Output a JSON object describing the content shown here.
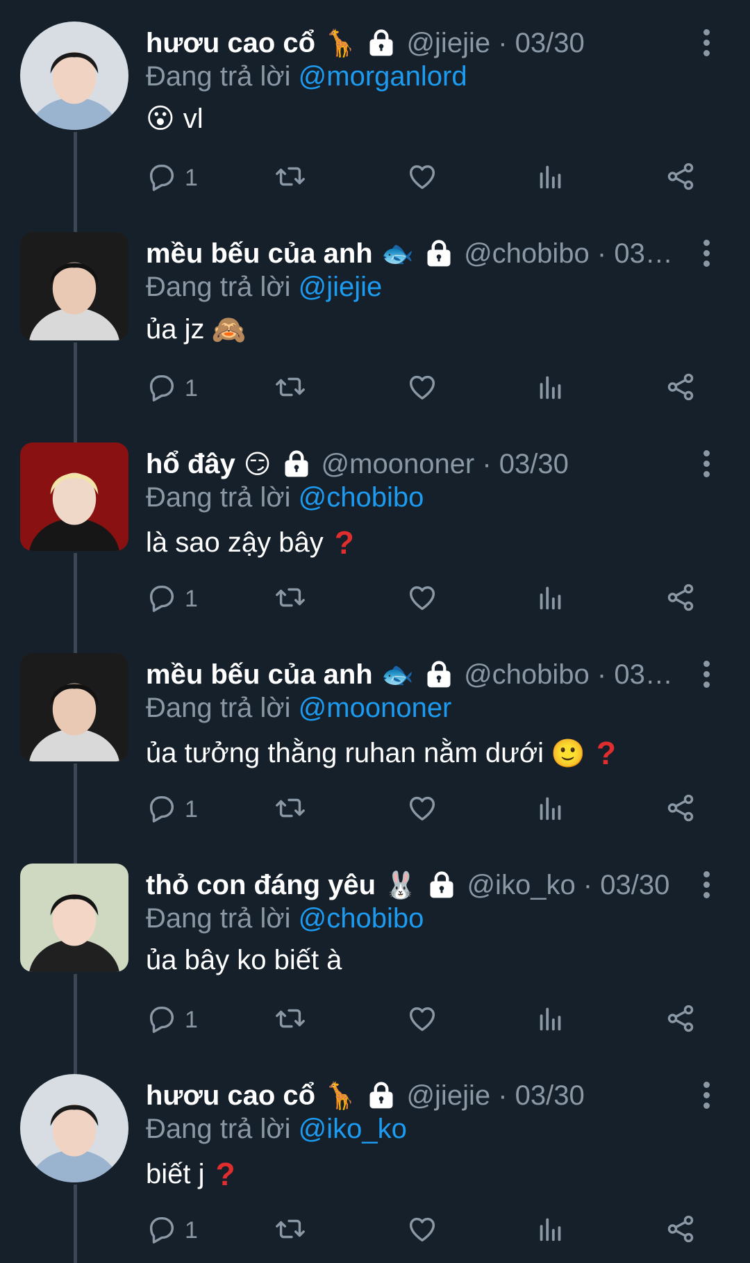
{
  "colors": {
    "background": "#15202b",
    "text": "#ffffff",
    "muted": "#8b98a5",
    "mention": "#1d9bf0",
    "thread_line": "#3b4754"
  },
  "replying_prefix": "Đang trả lời",
  "tweets": [
    {
      "name": "hươu cao cổ",
      "name_emoji": "🦒",
      "handle_date": "@jiejie · 03/30",
      "replying_to": "@morganlord",
      "text": "vl",
      "text_emoji_before": "😮",
      "text_suffix_icon": "",
      "reply_count": "1",
      "avatar_shape": "round"
    },
    {
      "name": "mều bếu của anh",
      "name_emoji": "🐟",
      "handle_date": "@chobibo · 03/...",
      "replying_to": "@jiejie",
      "text": "ủa jz",
      "text_emoji_before": "",
      "text_suffix_icon": "🙈",
      "reply_count": "1",
      "avatar_shape": "square"
    },
    {
      "name": "hổ đây",
      "name_emoji": "😏",
      "handle_date": "@moononer · 03/30",
      "replying_to": "@chobibo",
      "text": "là sao zậy bây",
      "text_emoji_before": "",
      "text_suffix_icon": "❓",
      "reply_count": "1",
      "avatar_shape": "square"
    },
    {
      "name": "mều bếu của anh",
      "name_emoji": "🐟",
      "handle_date": "@chobibo · 03/...",
      "replying_to": "@moononer",
      "text": "ủa tưởng thằng ruhan nằm dưới",
      "text_emoji_before": "",
      "text_suffix_icon": "🙂❓",
      "reply_count": "1",
      "avatar_shape": "square"
    },
    {
      "name": "thỏ con đáng yêu",
      "name_emoji": "🐰",
      "handle_date": "@iko_ko · 03/30",
      "replying_to": "@chobibo",
      "text": "ủa bây ko biết à",
      "text_emoji_before": "",
      "text_suffix_icon": "",
      "reply_count": "1",
      "avatar_shape": "square"
    },
    {
      "name": "hươu cao cổ",
      "name_emoji": "🦒",
      "handle_date": "@jiejie · 03/30",
      "replying_to": "@iko_ko",
      "text": "biết j",
      "text_emoji_before": "",
      "text_suffix_icon": "❓",
      "reply_count": "1",
      "avatar_shape": "round"
    }
  ],
  "icons": {
    "reply": "reply-icon",
    "retweet": "retweet-icon",
    "like": "heart-icon",
    "views": "analytics-icon",
    "share": "share-icon",
    "lock": "lock-icon",
    "more": "more-vertical-icon"
  }
}
